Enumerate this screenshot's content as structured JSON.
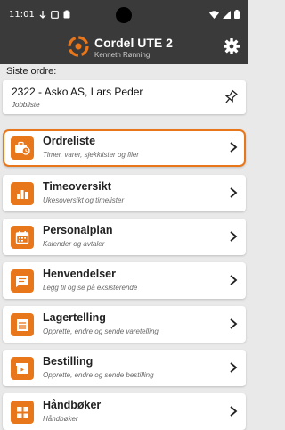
{
  "status_bar": {
    "time": "11:01"
  },
  "app": {
    "title": "Cordel UTE 2",
    "user": "Kenneth Rønning"
  },
  "last_orders": {
    "label": "Siste ordre:",
    "item": {
      "title": "2322 - Asko AS, Lars Peder",
      "subtitle": "Jobbliste"
    }
  },
  "menu": [
    {
      "title": "Ordreliste",
      "subtitle": "Timer, varer, sjekklister og filer",
      "icon": "briefcase-clock-icon",
      "selected": true
    },
    {
      "title": "Timeoversikt",
      "subtitle": "Ukesoversikt og timelister",
      "icon": "bar-chart-icon"
    },
    {
      "title": "Personalplan",
      "subtitle": "Kalender og avtaler",
      "icon": "calendar-icon"
    },
    {
      "title": "Henvendelser",
      "subtitle": "Legg til og se på eksisterende",
      "icon": "chat-icon"
    },
    {
      "title": "Lagertelling",
      "subtitle": "Opprette, endre og sende varetelling",
      "icon": "list-icon"
    },
    {
      "title": "Bestilling",
      "subtitle": "Opprette, endre og sende bestilling",
      "icon": "box-icon"
    },
    {
      "title": "Håndbøker",
      "subtitle": "Håndbøker",
      "icon": "grid-icon"
    }
  ],
  "colors": {
    "accent": "#e8761a",
    "header_bg": "#3a3a3a",
    "page_bg": "#e9e9e9"
  }
}
